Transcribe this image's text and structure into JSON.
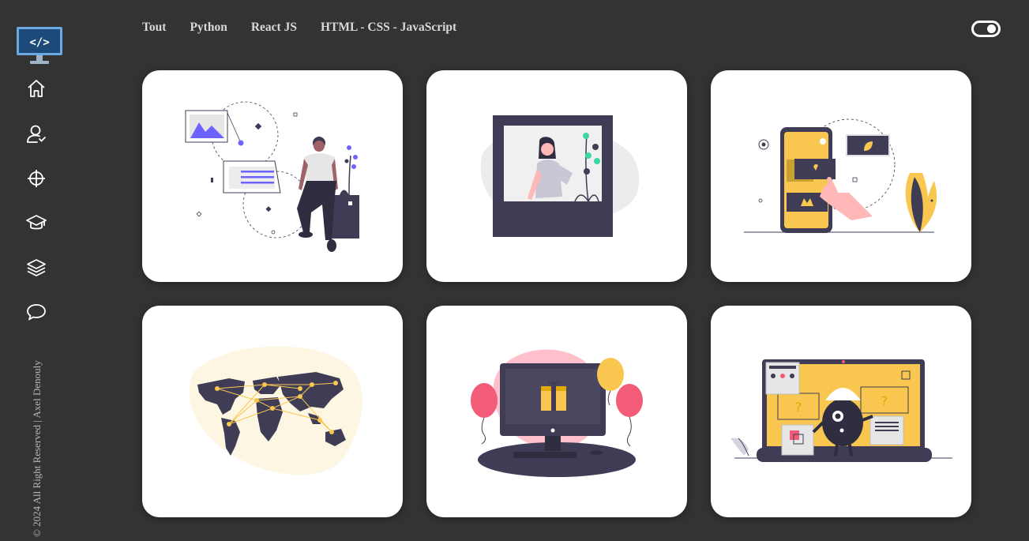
{
  "nav": {
    "filters": [
      "Tout",
      "Python",
      "React JS",
      "HTML - CSS - JavaScript"
    ]
  },
  "sidebar": {
    "icons": [
      "home-icon",
      "user-icon",
      "crosshair-icon",
      "graduation-cap-icon",
      "layers-icon",
      "chat-bubble-icon"
    ]
  },
  "footer": {
    "copyright": "© 2024 All Right Reserved | Axel Denouly"
  },
  "colors": {
    "background": "#333333",
    "card": "#ffffff",
    "accent_purple": "#6c63ff",
    "accent_yellow": "#f9c74f",
    "dark": "#3f3d56"
  },
  "projects": [
    {
      "illustration": "person-with-images-illustration"
    },
    {
      "illustration": "photo-frame-woman-illustration"
    },
    {
      "illustration": "smartphone-app-illustration"
    },
    {
      "illustration": "world-map-network-illustration"
    },
    {
      "illustration": "computer-gift-balloons-illustration"
    },
    {
      "illustration": "laptop-robot-illustration"
    }
  ]
}
